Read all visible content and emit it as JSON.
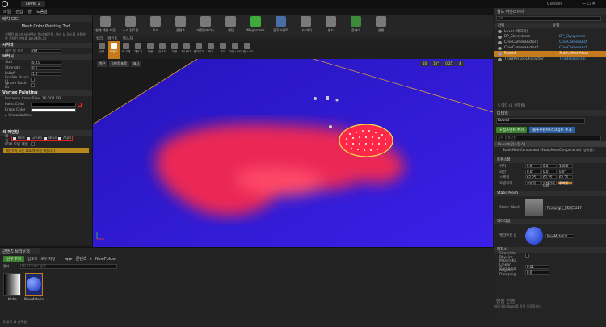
{
  "titlebar": {
    "tab": "Level 2",
    "right_label": "Classes"
  },
  "menu": [
    "파일",
    "편집",
    "창",
    "도움말"
  ],
  "left_panel": {
    "tabs": [
      "배치 모드",
      "게시 위치"
    ],
    "tool_title": "Mesh Color Painting Tool",
    "description": "선택된 메시에서 버텍스 컬러 페인트, 컬러 뷰 모드를 사용하여 적용된 변화를 표시해줍니다",
    "sections": {
      "paint_mode": {
        "title": "시각화",
        "label": "컬러 뷰 모드",
        "value": "Off"
      },
      "brush": {
        "title": "브러시",
        "rows": [
          {
            "label": "Size",
            "value": "0.25"
          },
          {
            "label": "Strength",
            "value": "0.5"
          },
          {
            "label": "Falloff",
            "value": "1.0"
          },
          {
            "label": "Enable Brush Fl",
            "value": ""
          },
          {
            "label": "Ignore Back-Fa",
            "value": ""
          }
        ]
      },
      "vertex": {
        "title": "Vertex Painting",
        "info": "Instance Color Size: 16.504 KB",
        "paint_color": "Paint Color",
        "erase_color": "Erase Color",
        "visualization": "Visualization"
      },
      "color_channel": {
        "title": "색 페인팅",
        "channel_label": "채널",
        "channels": [
          "Red",
          "Green",
          "Blue",
          "Alph"
        ],
        "lod_label": "LOD 모델 페인",
        "warning": "페인트가 모든 LOD에 적용 해봅니다"
      }
    }
  },
  "toolbar": [
    "현재 레벨 저장",
    "소스 컨트롤",
    "모드",
    "콘텐츠",
    "마켓플레이스",
    "세팅",
    "Megascans",
    "블루프린트",
    "시네마틱",
    "빌드",
    "플레이",
    "실행"
  ],
  "viewport": {
    "tabs": [
      "컬러",
      "페인트",
      "텍스처"
    ],
    "modes": [
      "선택",
      "페인트",
      "색 교체",
      "채우기",
      "적용",
      "임포트",
      "저장",
      "복사하기",
      "붙여넣기",
      "제거",
      "포트",
      "이전 LOD",
      "다음 LOD",
      "이전 LOD",
      "다음 LOD"
    ],
    "view_buttons": [
      "원근",
      "라이팅포함",
      "표시"
    ],
    "snap_values": {
      "grid": "10",
      "angle": "10°",
      "scale": "0.25",
      "camera": "4"
    }
  },
  "outliner": {
    "tab": "월드 아웃라이너",
    "search_placeholder": "검색",
    "col_label": "라벨",
    "col_type": "유형",
    "rows": [
      {
        "label": "Level (에디터)",
        "type": "",
        "selected": false
      },
      {
        "label": "BP_Skysystem",
        "type": "BP_Skysystem",
        "selected": false
      },
      {
        "label": "CineCameraActor1",
        "type": "CineCameraAct",
        "selected": false
      },
      {
        "label": "CineCameraActor2",
        "type": "CineCameraAct",
        "selected": false
      },
      {
        "label": "Round",
        "type": "StaticMeshActor",
        "selected": true
      },
      {
        "label": "ThirdPersonCharacter",
        "type": "ThirdPersonCh",
        "selected": false
      }
    ],
    "count": "5 액터 (1 선택됨)"
  },
  "details": {
    "tab": "디테일",
    "name": "Round",
    "add_component": "+컴포넌트 추가",
    "blueprint": "블루프린트/스크립트 추가",
    "search_placeholder": "검색 컴포넌트",
    "root": "Round(인스턴스)",
    "component": "StaticMeshComponent (StaticMeshComponent0) (상속됨)",
    "transform_title": "트랜스폼",
    "transform": [
      {
        "label": "위치",
        "x": "0.0",
        "y": "0.0",
        "z": "130.0"
      },
      {
        "label": "회전",
        "x": "0.0°",
        "y": "0.0°",
        "z": "0.0°"
      },
      {
        "label": "스케일",
        "x": "62.25",
        "y": "62.25",
        "z": "62.25"
      }
    ],
    "mobility": {
      "label": "모빌리티",
      "options": [
        "스태틱",
        "스테이셔너리",
        "무버블"
      ]
    },
    "static_mesh_title": "Static Mesh",
    "static_mesh_label": "Static Mesh",
    "static_mesh_value": "Rectangle_B58C52E7",
    "materials_title": "머티리얼",
    "element_label": "엘리먼트 0",
    "material_value": "NewMaterial",
    "physics_title": "피직스",
    "physics_rows": [
      {
        "label": "Simulate Physics",
        "value": ""
      },
      {
        "label": "MassInKg",
        "value": ""
      },
      {
        "label": "Linear Damping",
        "value": "0.01"
      },
      {
        "label": "Angular Damping",
        "value": "0.0"
      }
    ],
    "watermark_line1": "Windows 정품 인증",
    "watermark_line2": "[설정]으로 이동하여 Windows를 정품 인증합니다."
  },
  "content_browser": {
    "tab": "콘텐츠 브라우저",
    "add_new": "신규 추가",
    "import": "임포트",
    "save_all": "모두 저장",
    "path": [
      "콘텐츠",
      "NewFolder"
    ],
    "search_placeholder": "NewFolder 검색",
    "filter": "필터",
    "items": [
      {
        "name": "Alpha",
        "kind": "texture"
      },
      {
        "name": "NewMaterial",
        "kind": "material"
      }
    ],
    "count": "2 항목 (1 선택됨)"
  },
  "colors": {
    "accent": "#c57a1e",
    "blue_plane": "#2a1ad8",
    "paint_red": "#ff2a4a",
    "select_yellow": "#e8b84a"
  }
}
